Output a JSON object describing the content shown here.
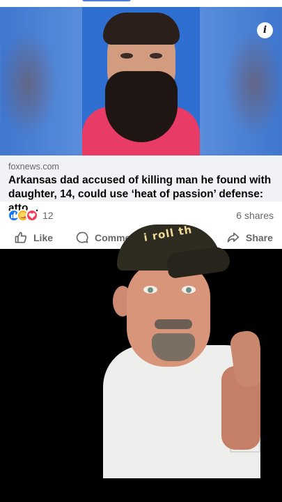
{
  "post": {
    "link": {
      "domain": "foxnews.com",
      "headline": "Arkansas dad accused of killing man he found with daughter, 14, could use ‘heat of passion’ defense: atto…",
      "info_icon": "info-icon"
    },
    "stats": {
      "reaction_icons": [
        "like-reaction-icon",
        "care-reaction-icon",
        "love-reaction-icon"
      ],
      "reaction_count": "12",
      "shares": "6 shares"
    },
    "actions": {
      "like_label": "Like",
      "comment_label": "Commen",
      "share_label": "Share"
    }
  },
  "video": {
    "cap_text": "i roll th"
  },
  "colors": {
    "facebook_blue": "#1877f2",
    "love_red": "#f33e58",
    "care_yellow": "#f7b125",
    "link_bg": "#f0f2f5",
    "mugshot_bg": "#2f6fd1",
    "shirt_pink": "#e83b66"
  }
}
